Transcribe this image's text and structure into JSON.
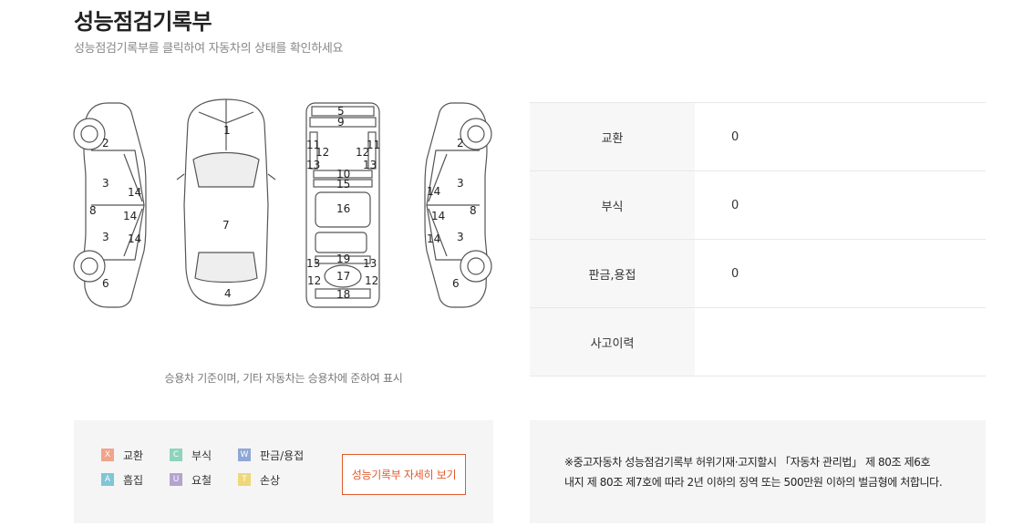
{
  "header": {
    "title": "성능점검기록부",
    "subtitle": "성능점검기록부를 클릭하여 자동차의 상태를 확인하세요"
  },
  "diagram": {
    "caption": "승용차 기준이며, 기타 자동차는 승용차에 준하여 표시",
    "left_view": [
      "2",
      "3",
      "14",
      "8",
      "14",
      "3",
      "14",
      "6"
    ],
    "top_view": [
      "1",
      "7",
      "4"
    ],
    "underside_view": [
      "5",
      "9",
      "11",
      "12",
      "12",
      "11",
      "13",
      "13",
      "10",
      "15",
      "16",
      "19",
      "13",
      "13",
      "17",
      "12",
      "12",
      "18"
    ],
    "right_view": [
      "2",
      "3",
      "14",
      "14",
      "8",
      "3",
      "14",
      "6"
    ]
  },
  "status_table": {
    "rows": [
      {
        "label": "교환",
        "value": "0"
      },
      {
        "label": "부식",
        "value": "0"
      },
      {
        "label": "판금,용접",
        "value": "0"
      },
      {
        "label": "사고이력",
        "value": ""
      }
    ]
  },
  "legend": {
    "items": [
      {
        "code": "X",
        "label": "교환",
        "color": "#f0a48b"
      },
      {
        "code": "C",
        "label": "부식",
        "color": "#8fd3bd"
      },
      {
        "code": "W",
        "label": "판금/용접",
        "color": "#8fa7d6"
      },
      {
        "code": "A",
        "label": "흠집",
        "color": "#7fc6d6"
      },
      {
        "code": "U",
        "label": "요철",
        "color": "#b5a3cf"
      },
      {
        "code": "T",
        "label": "손상",
        "color": "#efd77a"
      }
    ],
    "detail_button": "성능기록부 자세히 보기"
  },
  "notice": {
    "line1": "※중고자동차 성능점검기록부 허위기재·고지할시 「자동차 관리법」 제 80조 제6호",
    "line2": "내지 제 80조 제7호에 따라 2년 이하의 징역 또는 500만원 이하의 벌금형에 처합니다."
  },
  "colors": {
    "accent": "#e05a2b",
    "panel_bg": "#f5f5f5",
    "label_bg": "#f7f7f7"
  }
}
